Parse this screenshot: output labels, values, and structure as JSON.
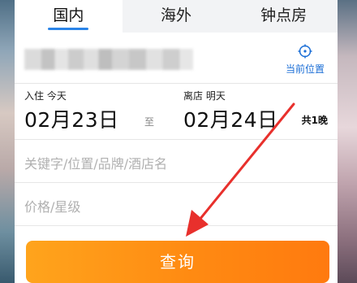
{
  "tabs": [
    {
      "label": "国内",
      "active": true
    },
    {
      "label": "海外",
      "active": false
    },
    {
      "label": "钟点房",
      "active": false
    }
  ],
  "location": {
    "current_location_label": "当前位置",
    "icon": "crosshair-icon"
  },
  "dates": {
    "checkin_label": "入住 今天",
    "checkin_date": "02月23日",
    "to_label": "至",
    "checkout_label": "离店 明天",
    "checkout_date": "02月24日",
    "nights": "共1晚"
  },
  "keyword": {
    "placeholder": "关键字/位置/品牌/酒店名"
  },
  "price": {
    "placeholder": "价格/星级"
  },
  "search": {
    "label": "查询"
  },
  "colors": {
    "accent_blue": "#2a84e8",
    "button_orange": "#ff8a12",
    "annotation_red": "#e8302c"
  }
}
